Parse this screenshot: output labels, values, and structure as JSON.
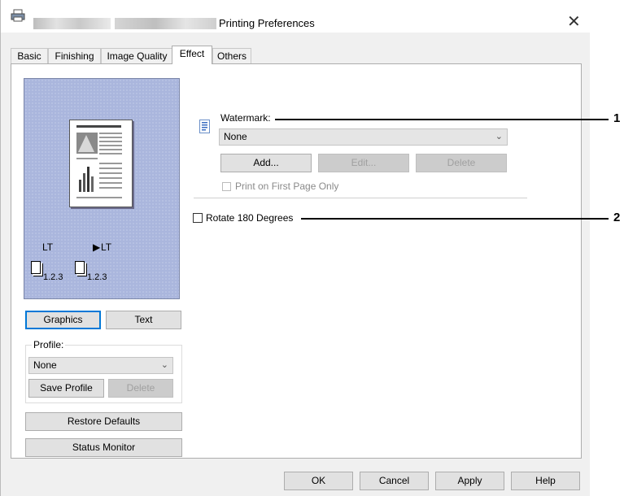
{
  "window": {
    "title": "Printing Preferences",
    "close_glyph": "✕"
  },
  "tabs": [
    {
      "label": "Basic",
      "active": false
    },
    {
      "label": "Finishing",
      "active": false
    },
    {
      "label": "Image Quality",
      "active": false
    },
    {
      "label": "Effect",
      "active": true
    },
    {
      "label": "Others",
      "active": false
    }
  ],
  "preview": {
    "source_size": "LT",
    "output_size": "LT",
    "source_order": "1.2.3",
    "output_order": "1.2.3"
  },
  "view_buttons": {
    "graphics": "Graphics",
    "text": "Text"
  },
  "profile": {
    "label": "Profile:",
    "selected": "None",
    "save_label": "Save Profile",
    "delete_label": "Delete"
  },
  "restore_defaults": "Restore Defaults",
  "status_monitor": "Status Monitor",
  "watermark": {
    "label": "Watermark:",
    "selected": "None",
    "add_label": "Add...",
    "edit_label": "Edit...",
    "delete_label": "Delete",
    "first_page_only_label": "Print on First Page Only",
    "first_page_only_checked": false
  },
  "rotate": {
    "label": "Rotate 180 Degrees",
    "checked": false
  },
  "footer": {
    "ok": "OK",
    "cancel": "Cancel",
    "apply": "Apply",
    "help": "Help"
  },
  "callouts": [
    "1",
    "2"
  ],
  "colors": {
    "preview_bg": "#aab6dd",
    "focus_border": "#0078d7",
    "button_bg": "#e1e1e1"
  }
}
